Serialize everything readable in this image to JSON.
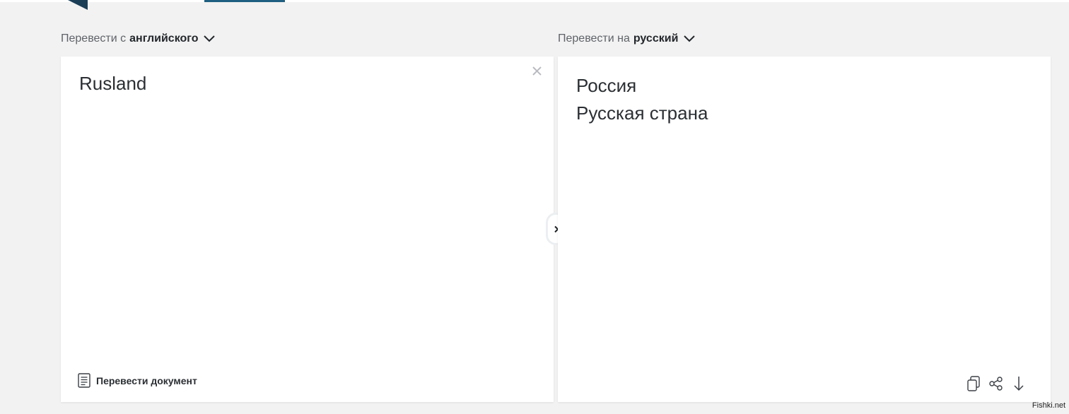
{
  "header": {
    "accent_color": "#1f5f82"
  },
  "source": {
    "label_prefix": "Перевести с",
    "language": "английского",
    "text": "Rusland",
    "translate_document_label": "Перевести документ"
  },
  "target": {
    "label_prefix": "Перевести на",
    "language": "русский",
    "lines": [
      "Россия",
      "Русская страна"
    ]
  },
  "icons": {
    "dropdown": "chevron-down-icon",
    "clear": "close-icon",
    "document": "document-icon",
    "swap": "chevron-right-icon",
    "copy": "copy-icon",
    "share": "share-icon",
    "download": "download-icon"
  },
  "watermark": "Fishki.net"
}
